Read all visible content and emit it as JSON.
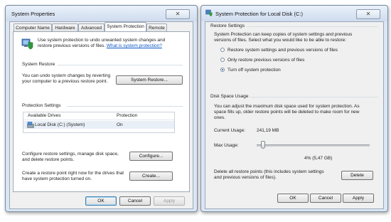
{
  "left": {
    "title": "System Properties",
    "tabs": [
      "Computer Name",
      "Hardware",
      "Advanced",
      "System Protection",
      "Remote"
    ],
    "intro_line1": "Use system protection to undo unwanted system changes and",
    "intro_line2": "restore previous versions of files.",
    "intro_link": "What is system protection?",
    "restore_group": "System Restore",
    "restore_text1": "You can undo system changes by reverting",
    "restore_text2": "your computer to a previous restore point.",
    "restore_button": "System Restore...",
    "settings_group": "Protection Settings",
    "col_drives": "Available Drives",
    "col_protection": "Protection",
    "drive_name": "Local Disk (C:) (System)",
    "drive_protection": "On",
    "configure_text1": "Configure restore settings, manage disk space,",
    "configure_text2": "and delete restore points.",
    "configure_button": "Configure...",
    "create_text1": "Create a restore point right now for the drives that",
    "create_text2": "have system protection turned on.",
    "create_button": "Create...",
    "ok": "OK",
    "cancel": "Cancel",
    "apply": "Apply"
  },
  "right": {
    "title": "System Protection for Local Disk (C:)",
    "restore_group": "Restore Settings",
    "restore_text1": "System Protection can keep copies of system settings and previous",
    "restore_text2": "versions of files. Select what you would like to be able to restore:",
    "option1": "Restore system settings and previous versions of files",
    "option2": "Only restore previous versions of files",
    "option3": "Turn off system protection",
    "selected_option": 3,
    "disk_group": "Disk Space Usage",
    "disk_text1": "You can adjust the maximum disk space used for system protection. As",
    "disk_text2": "space fills up, older restore points will be deleted to make room for new",
    "disk_text3": "ones.",
    "current_label": "Current Usage:",
    "current_value": "241,19 MB",
    "max_label": "Max Usage:",
    "max_fraction": 0.04,
    "max_value": "4% (5,47 GB)",
    "delete_text1": "Delete all restore points (this includes system settings",
    "delete_text2": "and previous versions of files).",
    "delete_button": "Delete",
    "ok": "OK",
    "cancel": "Cancel",
    "apply": "Apply"
  }
}
